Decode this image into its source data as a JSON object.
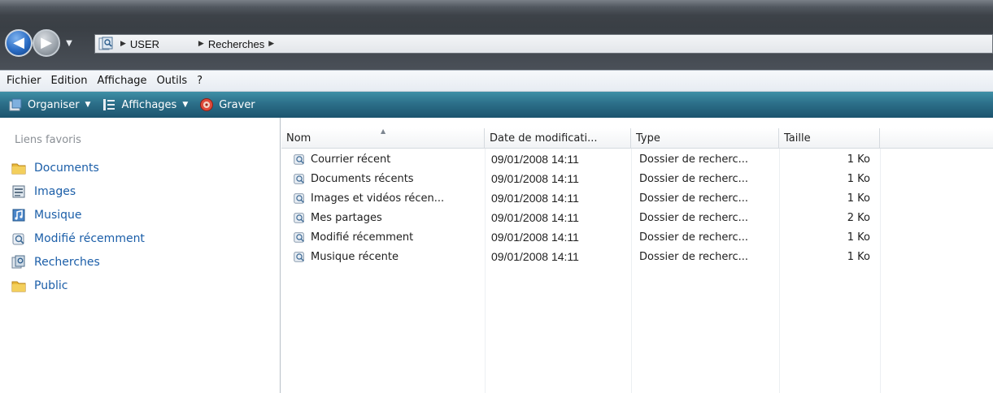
{
  "address_bar": {
    "crumbs": [
      "USER",
      "Recherches"
    ]
  },
  "menu": {
    "items": [
      "Fichier",
      "Edition",
      "Affichage",
      "Outils",
      "?"
    ]
  },
  "command_bar": {
    "organise_label": "Organiser",
    "views_label": "Affichages",
    "burn_label": "Graver"
  },
  "favorites": {
    "heading": "Liens favoris",
    "items": [
      {
        "label": "Documents",
        "icon": "folder-icon"
      },
      {
        "label": "Images",
        "icon": "pictures-icon"
      },
      {
        "label": "Musique",
        "icon": "music-icon"
      },
      {
        "label": "Modifié récemment",
        "icon": "saved-search-icon"
      },
      {
        "label": "Recherches",
        "icon": "searches-icon"
      },
      {
        "label": "Public",
        "icon": "folder-icon"
      }
    ]
  },
  "file_list": {
    "columns": [
      "Nom",
      "Date de modificati...",
      "Type",
      "Taille"
    ],
    "sorted_column": "Nom",
    "rows": [
      {
        "name": "Courrier récent",
        "date": "09/01/2008 14:11",
        "type": "Dossier de recherc...",
        "size": "1 Ko"
      },
      {
        "name": "Documents récents",
        "date": "09/01/2008 14:11",
        "type": "Dossier de recherc...",
        "size": "1 Ko"
      },
      {
        "name": "Images et vidéos récen...",
        "date": "09/01/2008 14:11",
        "type": "Dossier de recherc...",
        "size": "1 Ko"
      },
      {
        "name": "Mes partages",
        "date": "09/01/2008 14:11",
        "type": "Dossier de recherc...",
        "size": "2 Ko"
      },
      {
        "name": "Modifié récemment",
        "date": "09/01/2008 14:11",
        "type": "Dossier de recherc...",
        "size": "1 Ko"
      },
      {
        "name": "Musique récente",
        "date": "09/01/2008 14:11",
        "type": "Dossier de recherc...",
        "size": "1 Ko"
      }
    ]
  },
  "colors": {
    "link_blue": "#1b5ea8",
    "command_bar": "#2c6f89",
    "menu_bar": "#eef2f6"
  }
}
